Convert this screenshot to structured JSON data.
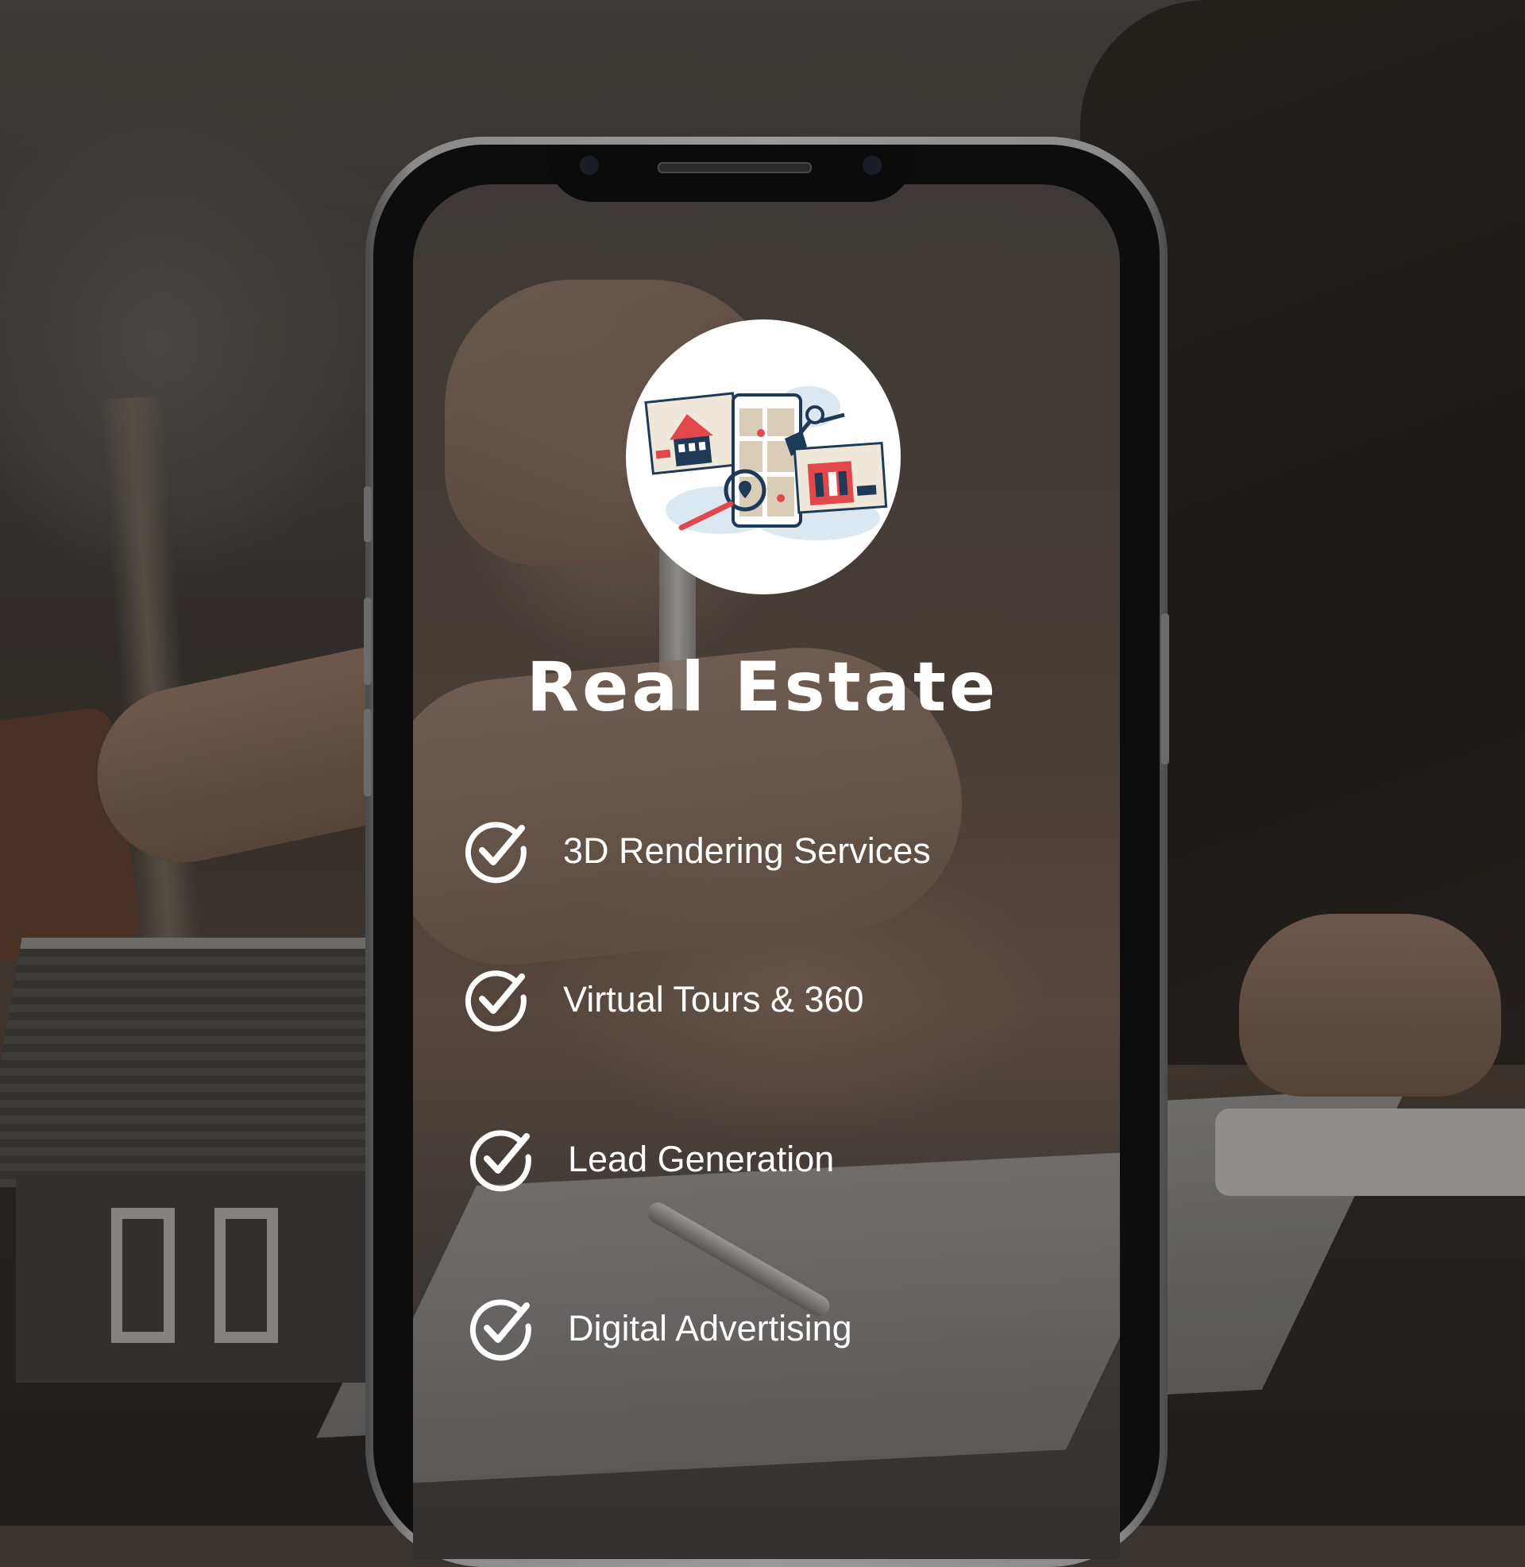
{
  "title": "Real Estate",
  "logo": {
    "icon": "real-estate-search-app-illustration"
  },
  "features": [
    {
      "label": "3D Rendering Services",
      "icon": "check-circle-icon"
    },
    {
      "label": "Virtual Tours & 360",
      "icon": "check-circle-icon"
    },
    {
      "label": "Lead Generation",
      "icon": "check-circle-icon"
    },
    {
      "label": "Digital Advertising",
      "icon": "check-circle-icon"
    }
  ],
  "colors": {
    "text": "#ffffff",
    "phone_frame": "#8a8a8a",
    "illustration_red": "#e2474b",
    "illustration_navy": "#1f3a57",
    "illustration_beige": "#d9cdb8"
  }
}
